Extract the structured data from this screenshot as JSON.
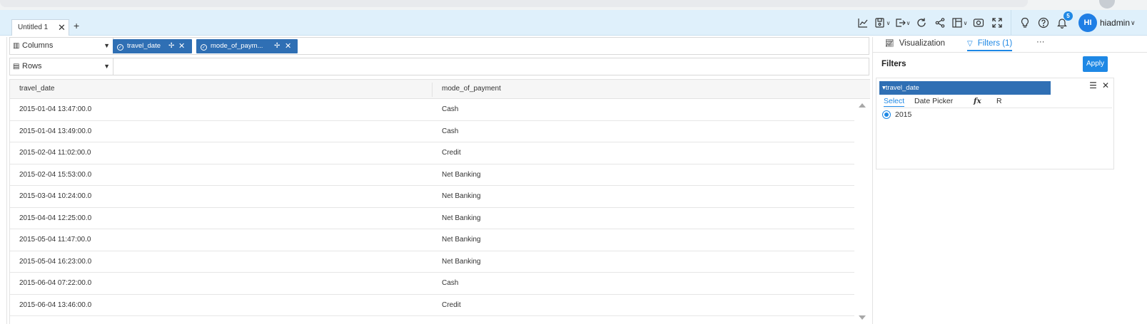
{
  "tabs": [
    {
      "label": "Untitled 1"
    }
  ],
  "toolbar": {
    "notification_count": "5",
    "user_initials": "HI",
    "user_name": "hiadmin"
  },
  "shelves": {
    "columns_label": "Columns",
    "rows_label": "Rows",
    "column_pills": [
      {
        "label": "travel_date"
      },
      {
        "label": "mode_of_paym..."
      }
    ]
  },
  "table": {
    "headers": [
      "travel_date",
      "mode_of_payment"
    ],
    "rows": [
      [
        "2015-01-04 13:47:00.0",
        "Cash"
      ],
      [
        "2015-01-04 13:49:00.0",
        "Cash"
      ],
      [
        "2015-02-04 11:02:00.0",
        "Credit"
      ],
      [
        "2015-02-04 15:53:00.0",
        "Net Banking"
      ],
      [
        "2015-03-04 10:24:00.0",
        "Net Banking"
      ],
      [
        "2015-04-04 12:25:00.0",
        "Net Banking"
      ],
      [
        "2015-05-04 11:47:00.0",
        "Net Banking"
      ],
      [
        "2015-05-04 16:23:00.0",
        "Net Banking"
      ],
      [
        "2015-06-04 07:22:00.0",
        "Cash"
      ],
      [
        "2015-06-04 13:46:00.0",
        "Credit"
      ]
    ]
  },
  "right_panel": {
    "tab_visualization": "Visualization",
    "tab_filters": "Filters (1)",
    "tab_more": "···",
    "filters_title": "Filters",
    "apply_label": "Apply",
    "filter": {
      "field": "travel_date",
      "tabs": [
        "Select",
        "Date Picker",
        "fx",
        "R"
      ],
      "option": "2015"
    }
  },
  "colors": {
    "accent": "#1e88e5",
    "pill": "#2f6fb4",
    "topbar": "#dff0fb"
  }
}
